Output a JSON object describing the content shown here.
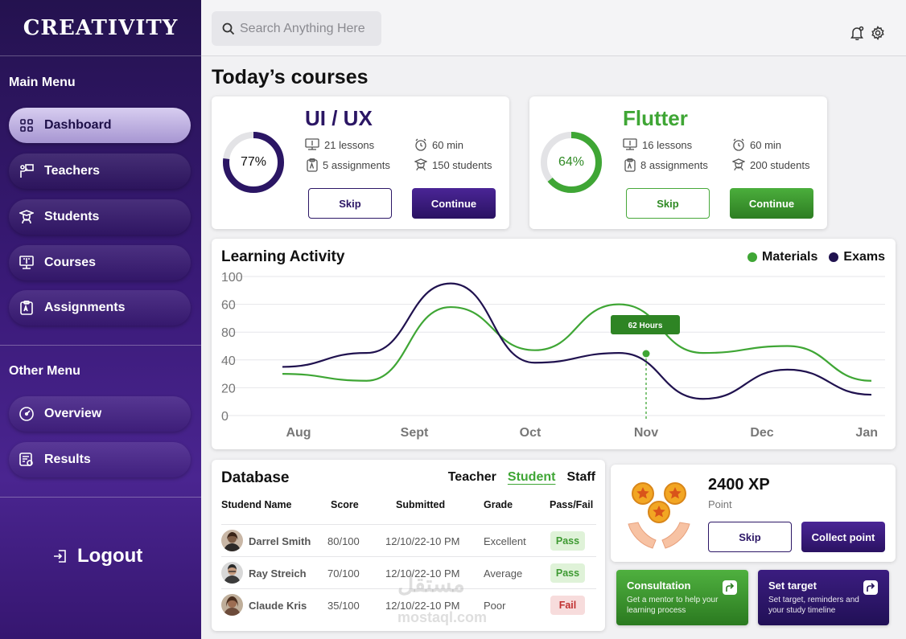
{
  "app": {
    "logo": "CREATIVITY"
  },
  "sidebar": {
    "main_menu_title": "Main Menu",
    "main_items": [
      {
        "label": "Dashboard",
        "icon": "grid-icon",
        "active": true
      },
      {
        "label": "Teachers",
        "icon": "teacher-board-icon",
        "active": false
      },
      {
        "label": "Students",
        "icon": "graduate-icon",
        "active": false
      },
      {
        "label": "Courses",
        "icon": "monitor-book-icon",
        "active": false
      },
      {
        "label": "Assignments",
        "icon": "clipboard-icon",
        "active": false
      }
    ],
    "other_menu_title": "Other Menu",
    "other_items": [
      {
        "label": "Overview",
        "icon": "gauge-icon"
      },
      {
        "label": "Results",
        "icon": "results-icon"
      }
    ],
    "logout_label": "Logout"
  },
  "header": {
    "search_placeholder": "Search Anything Here",
    "icons": [
      "bell-icon",
      "gear-icon"
    ]
  },
  "courses": {
    "title": "Today’s courses",
    "items": [
      {
        "name": "UI / UX",
        "percent": 77,
        "percent_label": "77%",
        "lessons": "21 lessons",
        "duration": "60 min",
        "assignments": "5 assignments",
        "students": "150 students",
        "skip_label": "Skip",
        "continue_label": "Continue",
        "accent": "#2b1664"
      },
      {
        "name": "Flutter",
        "percent": 64,
        "percent_label": "64%",
        "lessons": "16 lessons",
        "duration": "60 min",
        "assignments": "8 assignments",
        "students": "200 students",
        "skip_label": "Skip",
        "continue_label": "Continue",
        "accent": "#3fa635"
      }
    ]
  },
  "chart_data": {
    "type": "line",
    "title": "Learning Activity",
    "x": [
      "Aug",
      "Sept",
      "Oct",
      "Nov",
      "Dec",
      "Jan"
    ],
    "y_ticks": [
      "100",
      "60",
      "80",
      "40",
      "20",
      "0"
    ],
    "series": [
      {
        "name": "Materials",
        "color": "#3fa635",
        "values": [
          30,
          25,
          78,
          47,
          80,
          45,
          50,
          25
        ]
      },
      {
        "name": "Exams",
        "color": "#20124f",
        "values": [
          35,
          45,
          95,
          38,
          45,
          12,
          33,
          15
        ]
      }
    ],
    "tooltip": "62 Hours",
    "legend_position": "top-right",
    "grid": true
  },
  "database": {
    "title": "Database",
    "tabs": [
      {
        "label": "Teacher",
        "active": false
      },
      {
        "label": "Student",
        "active": true
      },
      {
        "label": "Staff",
        "active": false
      }
    ],
    "columns": [
      "Studend Name",
      "Score",
      "Submitted",
      "Grade",
      "Pass/Fail"
    ],
    "rows": [
      {
        "name": "Darrel Smith",
        "score": "80/100",
        "submitted": "12/10/22-10 PM",
        "grade": "Excellent",
        "status": "Pass"
      },
      {
        "name": "Ray Streich",
        "score": "70/100",
        "submitted": "12/10/22-10 PM",
        "grade": "Average",
        "status": "Pass"
      },
      {
        "name": "Claude Kris",
        "score": "35/100",
        "submitted": "12/10/22-10 PM",
        "grade": "Poor",
        "status": "Fail"
      }
    ]
  },
  "xp": {
    "value": "2400 XP",
    "label": "Point",
    "skip_label": "Skip",
    "collect_label": "Collect point"
  },
  "actions": [
    {
      "title": "Consultation",
      "desc": "Get a mentor to help your learning process"
    },
    {
      "title": "Set target",
      "desc": "Set target, reminders and your study timeline"
    }
  ],
  "watermark": {
    "arabic": "مستقل",
    "latin": "mostaql.com"
  }
}
